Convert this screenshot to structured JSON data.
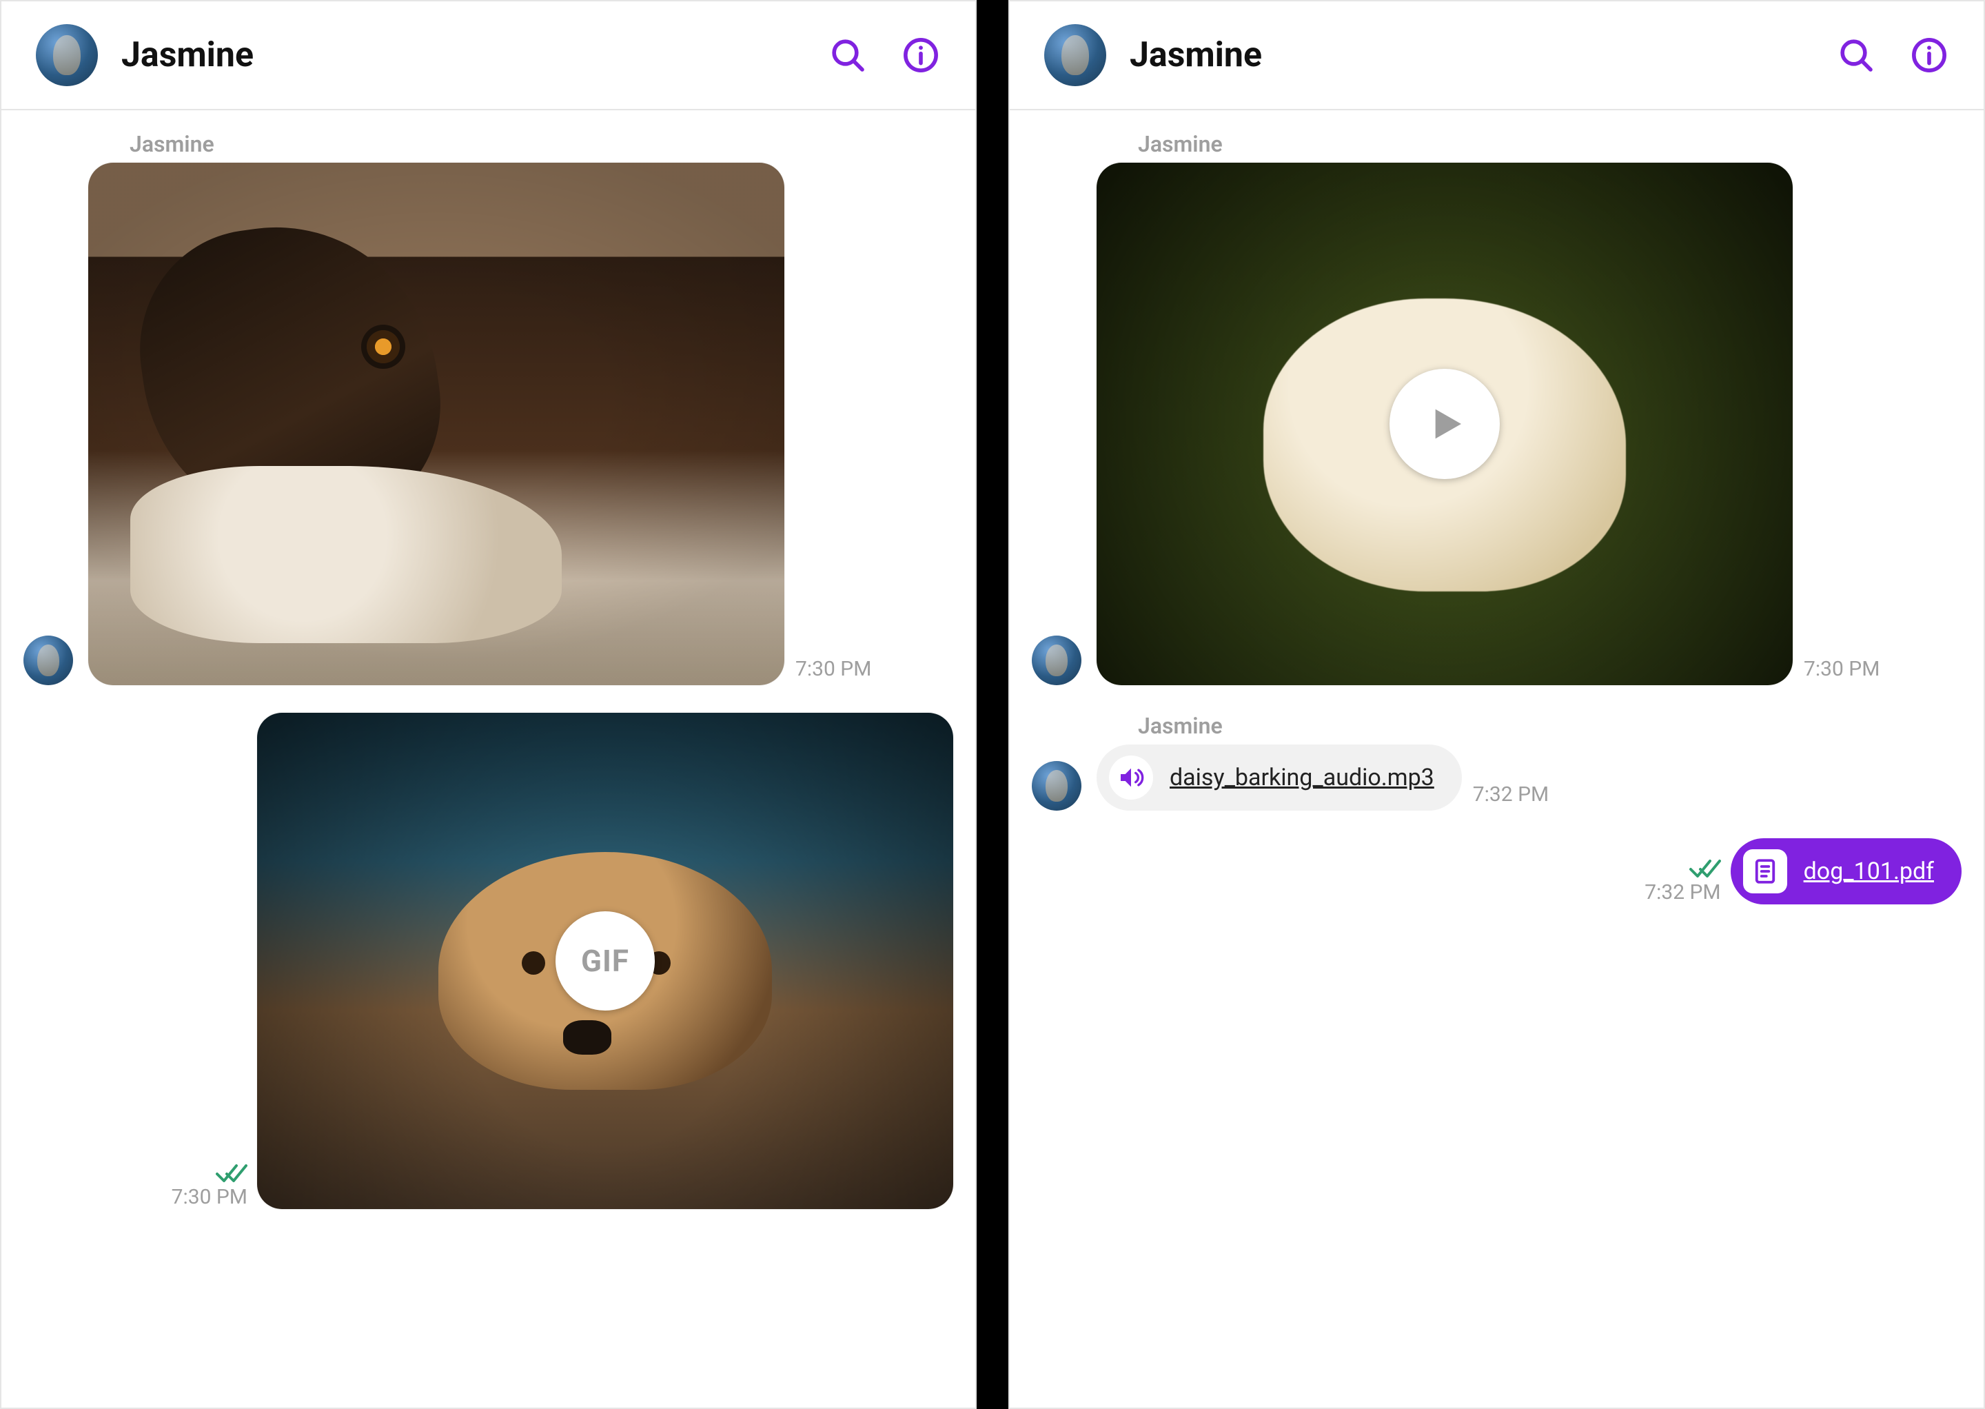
{
  "colors": {
    "accent": "#8022e0",
    "success": "#2f9e6f",
    "muted": "#9e9e9e"
  },
  "left": {
    "header": {
      "title": "Jasmine"
    },
    "messages": {
      "incoming_sender": "Jasmine",
      "incoming_image_time": "7:30 PM",
      "outgoing_gif_label": "GIF",
      "outgoing_gif_time": "7:30 PM"
    }
  },
  "right": {
    "header": {
      "title": "Jasmine"
    },
    "messages": {
      "incoming_sender_1": "Jasmine",
      "incoming_video_time": "7:30 PM",
      "incoming_sender_2": "Jasmine",
      "audio_filename": "daisy_barking_audio.mp3",
      "audio_time": "7:32 PM",
      "pdf_filename": "dog_101.pdf",
      "pdf_time": "7:32 PM"
    }
  }
}
